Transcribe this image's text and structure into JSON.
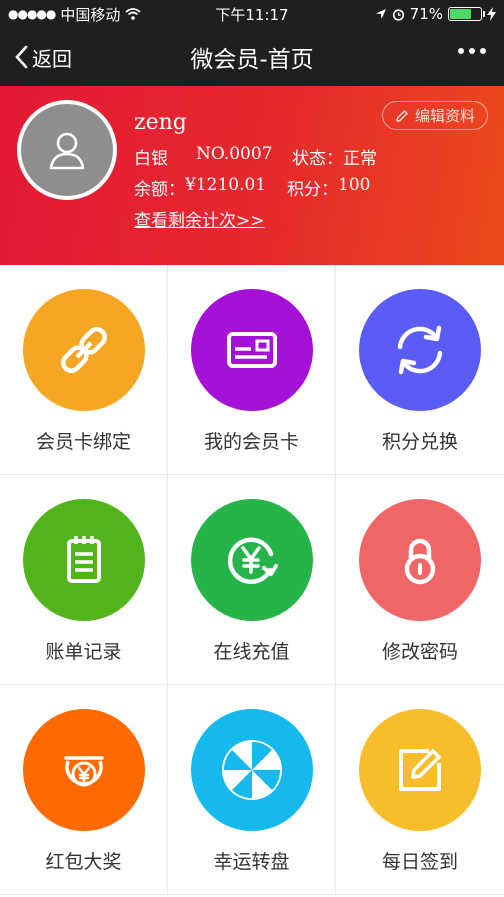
{
  "status_bar": {
    "carrier": "中国移动",
    "time": "下午11:17",
    "battery": "71%",
    "battery_level": 0.71
  },
  "nav": {
    "back_label": "返回",
    "title": "微会员-首页"
  },
  "profile": {
    "name": "zeng",
    "level": "白银",
    "member_no": "NO.0007",
    "status_label": "状态：",
    "status_value": "正常",
    "balance_label": "余额：",
    "balance_value": "¥1210.01",
    "points_label": "积分：",
    "points_value": "100",
    "remaining_link": "查看剩余计次>>",
    "edit_label": "编辑资料"
  },
  "menu": [
    {
      "label": "会员卡绑定",
      "color": "#f5a623",
      "icon": "link-icon"
    },
    {
      "label": "我的会员卡",
      "color": "#a511d6",
      "icon": "card-icon"
    },
    {
      "label": "积分兑换",
      "color": "#5b5cf6",
      "icon": "refresh-icon"
    },
    {
      "label": "账单记录",
      "color": "#52b41b",
      "icon": "notepad-icon"
    },
    {
      "label": "在线充值",
      "color": "#25b34a",
      "icon": "yen-recharge-icon"
    },
    {
      "label": "修改密码",
      "color": "#f06666",
      "icon": "lock-icon"
    },
    {
      "label": "红包大奖",
      "color": "#ff6a00",
      "icon": "red-packet-icon"
    },
    {
      "label": "幸运转盘",
      "color": "#16b9ee",
      "icon": "wheel-icon"
    },
    {
      "label": "每日签到",
      "color": "#f7bd2a",
      "icon": "sign-edit-icon"
    }
  ]
}
